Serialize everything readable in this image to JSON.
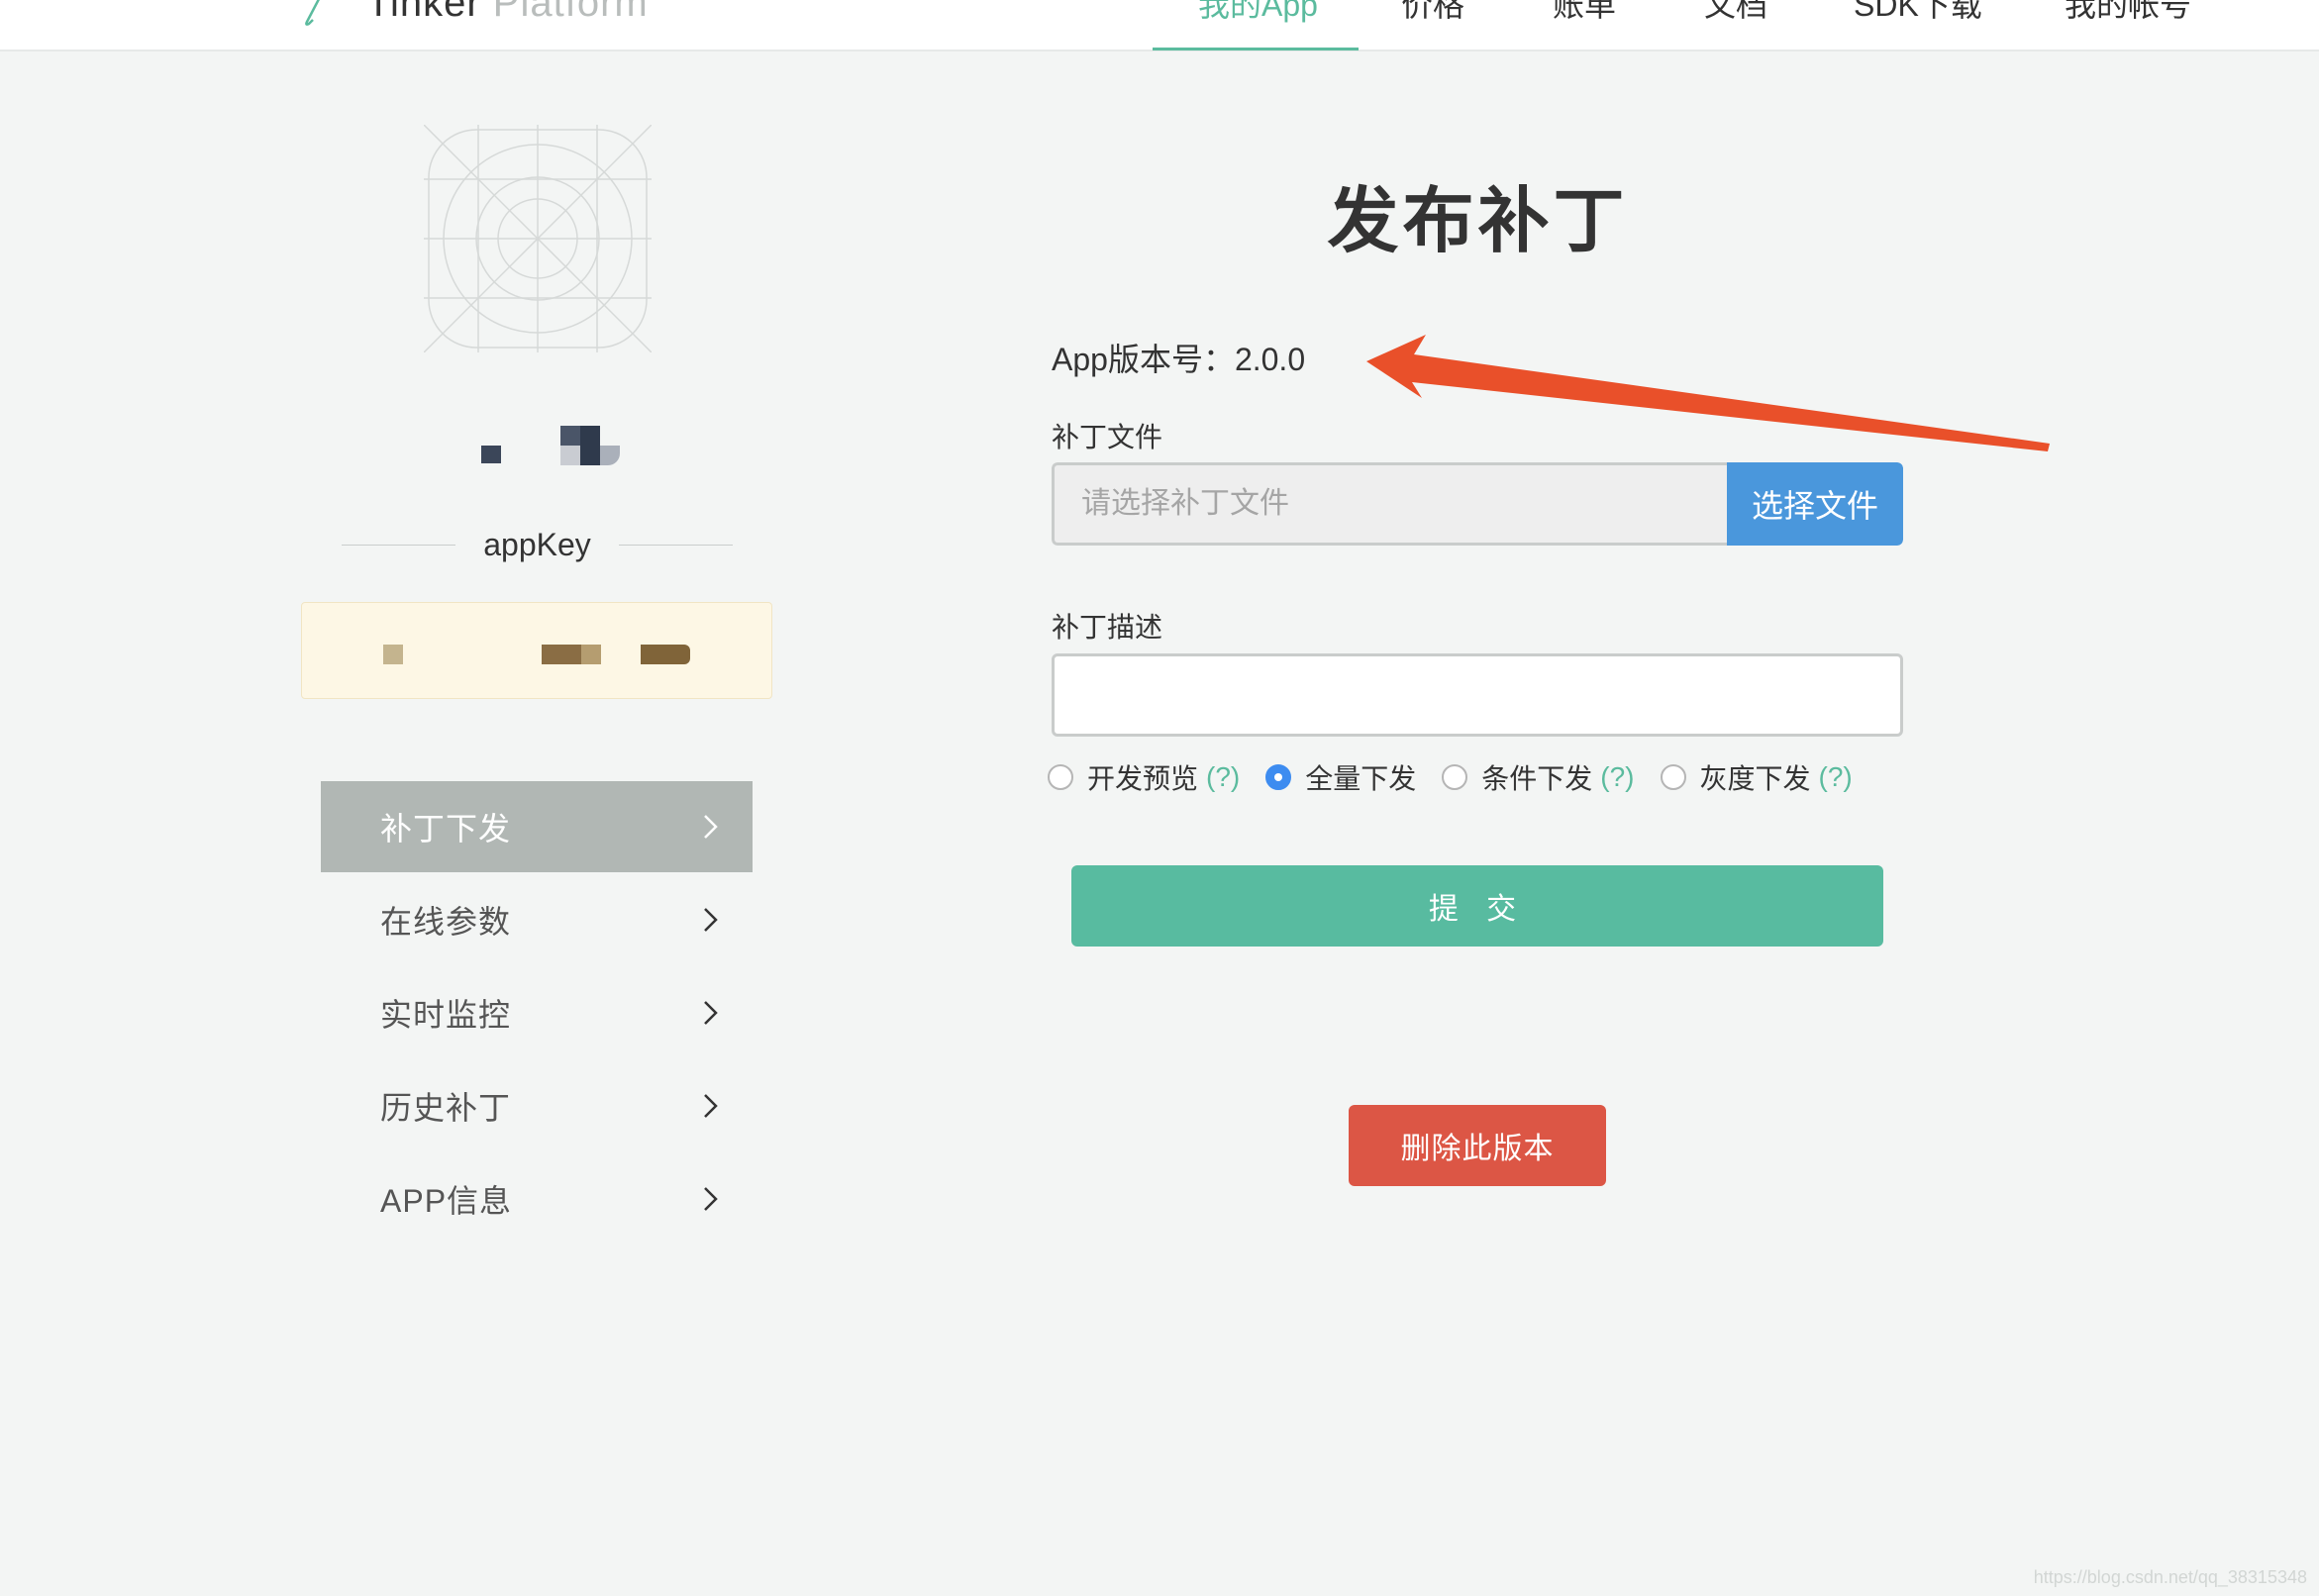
{
  "header": {
    "brand_primary": "Tinker",
    "brand_secondary": "Platform",
    "nav": [
      "我的App",
      "价格",
      "账单",
      "文档",
      "SDK下载",
      "我的帐号"
    ],
    "active_nav": "我的App",
    "accent_color": "#5bbb9e"
  },
  "sidebar": {
    "appkey_label": "appKey",
    "menu": [
      "补丁下发",
      "在线参数",
      "实时监控",
      "历史补丁",
      "APP信息"
    ],
    "active_menu": "补丁下发",
    "chevron_icon": "chevron-right-icon"
  },
  "form": {
    "title": "发布补丁",
    "version_text": "App版本号：2.0.0",
    "patch_file_label": "补丁文件",
    "patch_file_placeholder": "请选择补丁文件",
    "choose_file_button": "选择文件",
    "description_label": "补丁描述",
    "description_value": "",
    "release_options": [
      {
        "label": "开发预览",
        "help": "(?)",
        "checked": false
      },
      {
        "label": "全量下发",
        "help": "",
        "checked": true
      },
      {
        "label": "条件下发",
        "help": "(?)",
        "checked": false
      },
      {
        "label": "灰度下发",
        "help": "(?)",
        "checked": false
      }
    ],
    "submit_button": "提 交",
    "delete_button": "删除此版本"
  },
  "colors": {
    "submit": "#58bba0",
    "delete": "#dc5645",
    "choose_file": "#4a97dc",
    "annotation_arrow": "#e9502a"
  },
  "watermark": "https://blog.csdn.net/qq_38315348"
}
